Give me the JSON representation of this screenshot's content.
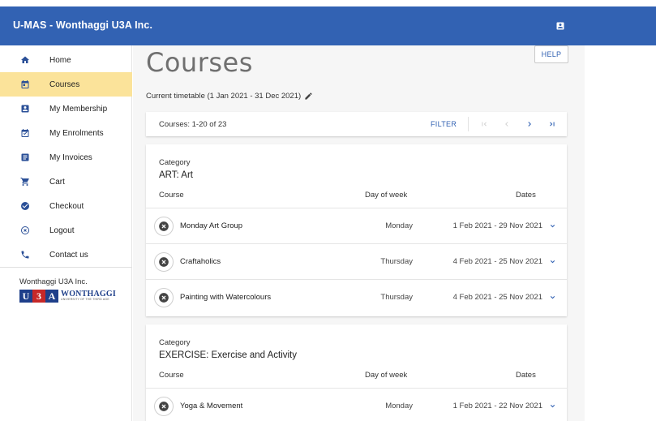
{
  "app": {
    "title": "U-MAS - Wonthaggi U3A Inc.",
    "account_icon": "account-box-icon"
  },
  "sidebar": {
    "items": [
      {
        "label": "Home",
        "icon": "home-icon",
        "active": false
      },
      {
        "label": "Courses",
        "icon": "calendar-icon",
        "active": true
      },
      {
        "label": "My Membership",
        "icon": "membership-card-icon",
        "active": false
      },
      {
        "label": "My Enrolments",
        "icon": "calendar-check-icon",
        "active": false
      },
      {
        "label": "My Invoices",
        "icon": "invoice-list-icon",
        "active": false
      },
      {
        "label": "Cart",
        "icon": "cart-icon",
        "active": false
      },
      {
        "label": "Checkout",
        "icon": "check-circle-icon",
        "active": false
      },
      {
        "label": "Logout",
        "icon": "close-circle-icon",
        "active": false
      },
      {
        "label": "Contact us",
        "icon": "phone-icon",
        "active": false
      }
    ],
    "org_name": "Wonthaggi U3A Inc.",
    "logo": {
      "blocks": [
        "U",
        "3",
        "A"
      ],
      "block_colors": [
        "#1e3f8a",
        "#c62828",
        "#1e3f8a"
      ],
      "word": "WONTHAGGI",
      "sub": "UNIVERSITY OF THE THIRD AGE"
    }
  },
  "main": {
    "title": "Courses",
    "help_label": "HELP",
    "timetable": "Current timetable (1 Jan 2021 - 31 Dec 2021)",
    "pagination": {
      "range": "Courses: 1-20 of 23",
      "filter_label": "FILTER"
    },
    "categories": [
      {
        "caption": "Category",
        "name": "ART: Art",
        "col_course": "Course",
        "col_day": "Day of week",
        "col_dates": "Dates",
        "courses": [
          {
            "name": "Monday Art Group",
            "day": "Monday",
            "dates": "1 Feb 2021 - 29 Nov 2021"
          },
          {
            "name": "Craftaholics",
            "day": "Thursday",
            "dates": "4 Feb 2021 - 25 Nov 2021"
          },
          {
            "name": "Painting with Watercolours",
            "day": "Thursday",
            "dates": "4 Feb 2021 - 25 Nov 2021"
          }
        ]
      },
      {
        "caption": "Category",
        "name": "EXERCISE: Exercise and Activity",
        "col_course": "Course",
        "col_day": "Day of week",
        "col_dates": "Dates",
        "courses": [
          {
            "name": "Yoga & Movement",
            "day": "Monday",
            "dates": "1 Feb 2021 - 22 Nov 2021"
          }
        ]
      }
    ]
  },
  "colors": {
    "primary": "#3262b3",
    "active_nav": "#fbe39a",
    "background": "#f6f6f6"
  }
}
